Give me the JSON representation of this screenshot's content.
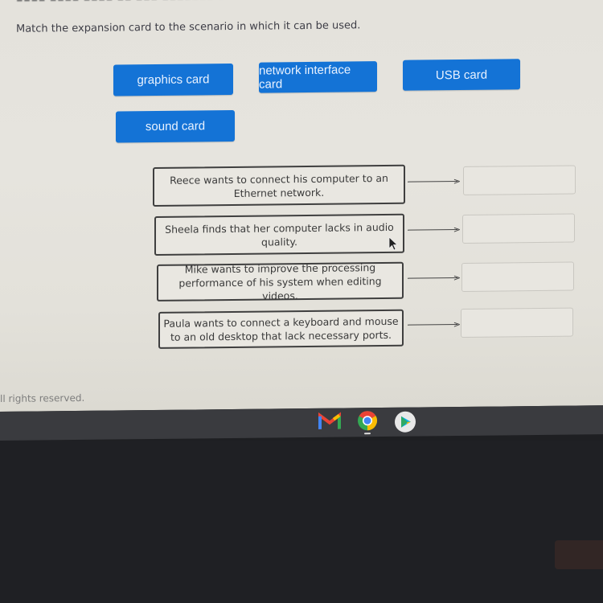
{
  "question": {
    "cut_off_header": "▪▪▪▪ ▪▪▪▪ ▪▪▪▪ ▪▪ ▪▪▪ ▪▪▪▪▪▪▪ ▪▪▪",
    "instruction": "Match the expansion card to the scenario in which it can be used."
  },
  "tiles": [
    {
      "label": "graphics card"
    },
    {
      "label": "network interface card"
    },
    {
      "label": "USB card"
    },
    {
      "label": "sound card"
    }
  ],
  "scenarios": [
    {
      "text": "Reece wants to connect his computer to an Ethernet network.",
      "answer": ""
    },
    {
      "text": "Sheela finds that her computer lacks in audio quality.",
      "answer": ""
    },
    {
      "text": "Mike wants to improve the processing performance of his system when editing videos.",
      "answer": ""
    },
    {
      "text": "Paula wants to connect a keyboard and mouse to an old desktop that lack necessary ports.",
      "answer": ""
    }
  ],
  "footer": {
    "text": "ll rights reserved."
  },
  "shelf": {
    "apps": [
      {
        "name": "Gmail",
        "icon": "gmail-icon"
      },
      {
        "name": "Chrome",
        "icon": "chrome-icon",
        "active": true
      },
      {
        "name": "Play Store",
        "icon": "play-store-icon"
      }
    ]
  },
  "colors": {
    "tile": "#1473d6",
    "tile_text": "#e9f2ff",
    "page_bg": "#e4e2dc",
    "shelf": "#3a3b3f"
  }
}
